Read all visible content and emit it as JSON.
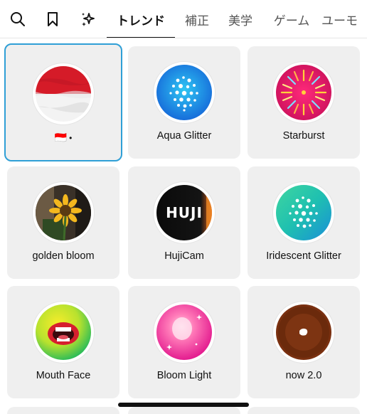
{
  "tabs": {
    "search_icon": "search-icon",
    "saved_icon": "bookmark-icon",
    "sparkle_icon": "sparkle-icon",
    "items": [
      {
        "label": "トレンド",
        "active": true
      },
      {
        "label": "補正",
        "active": false
      },
      {
        "label": "美学",
        "active": false
      },
      {
        "label": "ゲーム",
        "active": false
      },
      {
        "label": "ユーモ",
        "active": false
      }
    ]
  },
  "effects": [
    {
      "name": "🇮🇩",
      "suffix": "•",
      "selected": true,
      "thumb": "indonesia-flag"
    },
    {
      "name": "Aqua Glitter",
      "selected": false,
      "thumb": "aqua-glitter"
    },
    {
      "name": "Starburst",
      "selected": false,
      "thumb": "starburst"
    },
    {
      "name": "golden bloom",
      "selected": false,
      "thumb": "sunflower"
    },
    {
      "name": "HujiCam",
      "selected": false,
      "thumb": "huji",
      "thumb_text": "HUJI"
    },
    {
      "name": "Iridescent Glitter",
      "selected": false,
      "thumb": "iridescent-glitter"
    },
    {
      "name": "Mouth Face",
      "selected": false,
      "thumb": "mouth"
    },
    {
      "name": "Bloom Light",
      "selected": false,
      "thumb": "bloom-light"
    },
    {
      "name": "now 2.0",
      "selected": false,
      "thumb": "now-donut"
    }
  ],
  "colors": {
    "selected_border": "#2f9fd6",
    "card_bg": "#efefef"
  }
}
